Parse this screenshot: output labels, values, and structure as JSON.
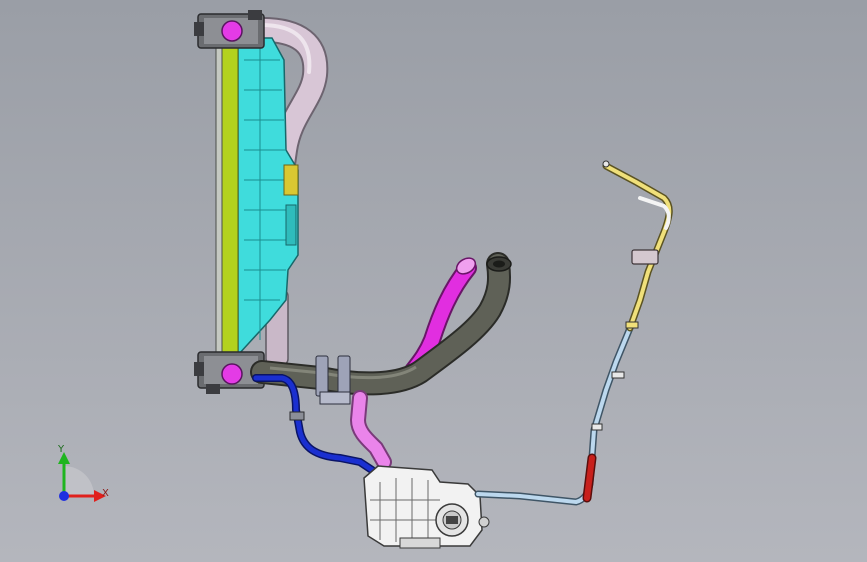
{
  "scene": {
    "background_top": "#9a9ea6",
    "background_bottom": "#b4b6bd"
  },
  "triad": {
    "x_label": "X",
    "y_label": "Y",
    "x_color": "#e0201c",
    "y_color": "#1fb51f",
    "z_color": "#1f2fe0"
  },
  "parts": {
    "radiator_core_color": "#b3d21e",
    "fan_shroud_color": "#3fdcdc",
    "upper_hose_color": "#d8c6d6",
    "lower_hose_color": "#5f6157",
    "magenta_hose_color": "#e12ee0",
    "pink_hose_color": "#ea84ea",
    "blue_hose_color": "#1a2fd0",
    "light_blue_line_color": "#bcd8ee",
    "yellow_line_color": "#f0e07a",
    "red_segment_color": "#c8201c",
    "reservoir_color": "#f2f2f2"
  }
}
